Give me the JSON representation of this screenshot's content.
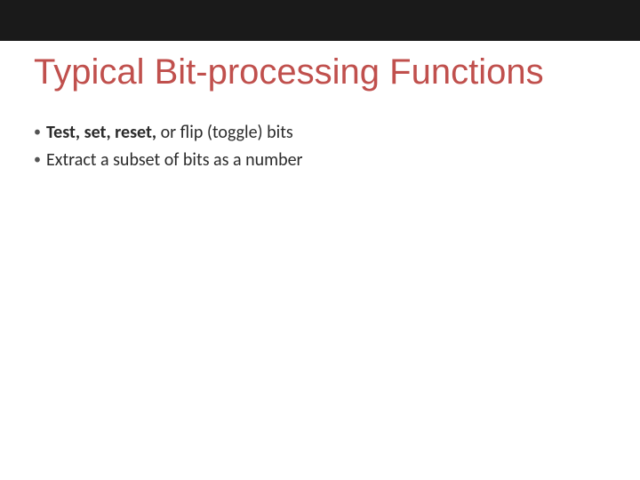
{
  "title": "Typical Bit-processing Functions",
  "bullets": [
    {
      "bold_fragment": "Test, set, reset,",
      "rest_fragment": " or flip (toggle) bits"
    },
    {
      "bold_fragment": "",
      "rest_fragment": "Extract a subset of bits as a number"
    }
  ],
  "glyphs": {
    "bullet": "•"
  },
  "colors": {
    "title": "#c0504d",
    "topbar": "#1a1a1a",
    "text": "#2b2b2b"
  }
}
